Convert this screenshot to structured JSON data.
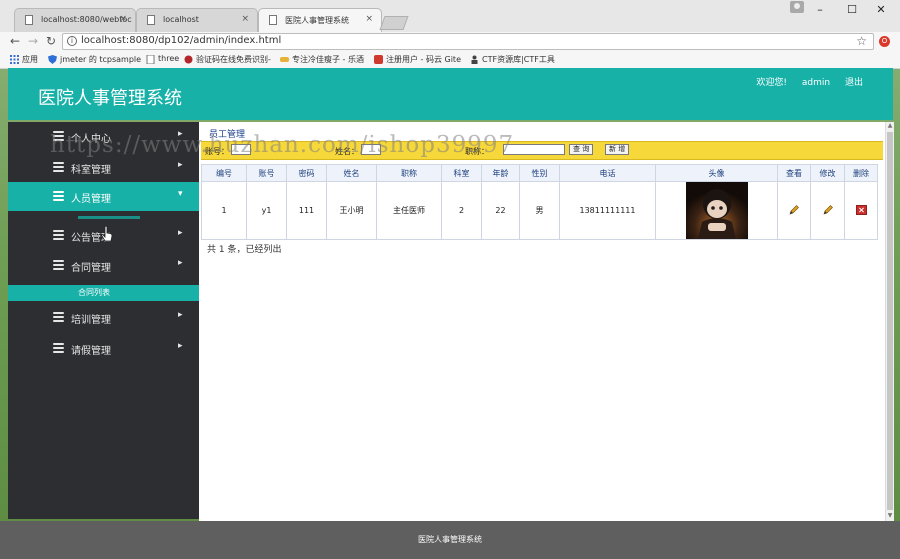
{
  "browser": {
    "tabs": [
      {
        "title": "localhost:8080/webtoc",
        "active": false
      },
      {
        "title": "localhost",
        "active": false
      },
      {
        "title": "医院人事管理系统",
        "active": true
      }
    ],
    "close_glyph": "×",
    "url": "localhost:8080/dp102/admin/index.html",
    "bookmarks": [
      "应用",
      "jmeter 的 tcpsample",
      "three",
      "验证码在线免费识别-",
      "专注冷佳瘦子 - 乐酒",
      "注册用户 - 码云 Gite",
      "CTF资源库|CTF工具"
    ],
    "window_controls": {
      "minimize": "–",
      "maximize": "☐",
      "close": "✕"
    },
    "ext_glyph": "O"
  },
  "app": {
    "title": "医院人事管理系统",
    "welcome": "欢迎您!",
    "username": "admin",
    "logout": "退出"
  },
  "sidebar": {
    "items": [
      {
        "label": "个人中心",
        "active": false
      },
      {
        "label": "科室管理",
        "active": false
      },
      {
        "label": "人员管理",
        "active": true,
        "arrow": "down"
      },
      {
        "label": "公告管理",
        "active": false
      },
      {
        "label": "合同管理",
        "active": false
      },
      {
        "label": "培训管理",
        "active": false
      },
      {
        "label": "请假管理",
        "active": false
      }
    ],
    "open_submenu": "合同列表"
  },
  "main": {
    "breadcrumb": "员工管理",
    "search": {
      "account_label": "账号：",
      "name_label": "姓名：",
      "title_label": "职称：",
      "query_button": "查 询",
      "add_button": "新 增"
    },
    "table": {
      "headers": [
        "编号",
        "账号",
        "密码",
        "姓名",
        "职称",
        "科室",
        "年龄",
        "性别",
        "电话",
        "头像",
        "查看",
        "修改",
        "删除"
      ],
      "rows": [
        {
          "id": "1",
          "account": "y1",
          "password": "111",
          "name": "王小明",
          "title": "主任医师",
          "dept": "2",
          "age": "22",
          "gender": "男",
          "phone": "13811111111"
        }
      ]
    },
    "summary": "共 1 条，已经列出"
  },
  "footer": "医院人事管理系统",
  "watermark": "https://www.huzhan.com/ishop39997",
  "colors": {
    "accent": "#17b1a8",
    "sidebar": "#2d2e32",
    "search_bar": "#f7d83a"
  }
}
